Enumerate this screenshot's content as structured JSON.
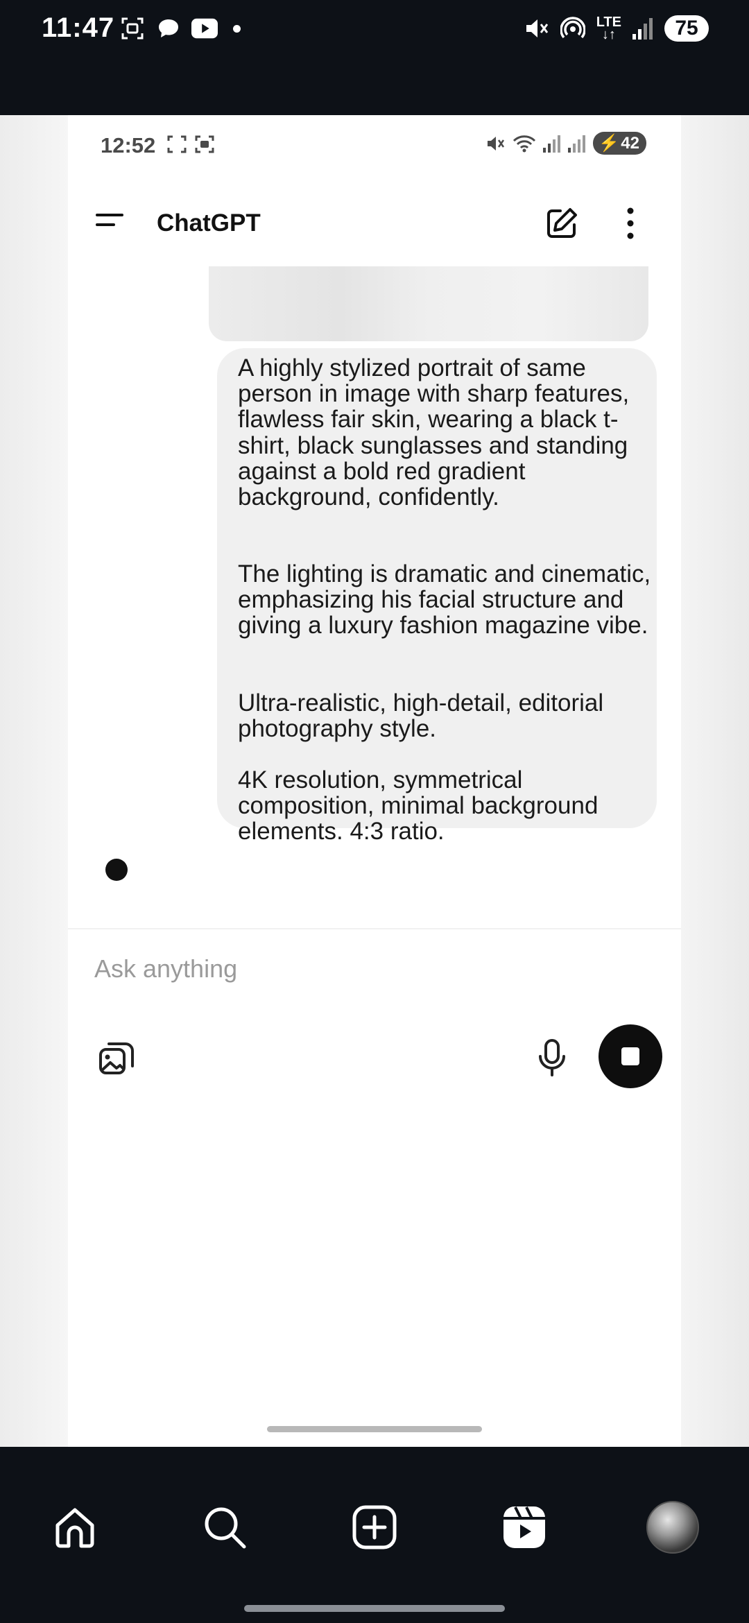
{
  "outer_status": {
    "time": "11:47",
    "network": "LTE",
    "battery": "75"
  },
  "inner_status": {
    "time": "12:52",
    "battery": "42"
  },
  "header": {
    "title": "ChatGPT"
  },
  "chat": {
    "user_message": {
      "p1": "A highly stylized portrait of same person in image with sharp features, flawless fair skin, wearing a black t-shirt, black sunglasses and standing against a bold red gradient background, confidently.",
      "p2": "The lighting is dramatic and cinematic, emphasizing his facial structure and giving a luxury fashion magazine vibe.",
      "p3": "Ultra-realistic, high-detail, editorial photography style.",
      "p4": "4K resolution, symmetrical composition, minimal background elements. 4:3 ratio."
    }
  },
  "composer": {
    "placeholder": "Ask anything"
  },
  "icons": {
    "menu": "menu-icon",
    "new_chat": "edit-icon",
    "more": "more-vertical-icon",
    "attach": "image-icon",
    "mic": "microphone-icon",
    "stop": "stop-icon",
    "nav": [
      "home-icon",
      "search-icon",
      "create-icon",
      "reels-icon",
      "profile-avatar"
    ]
  }
}
